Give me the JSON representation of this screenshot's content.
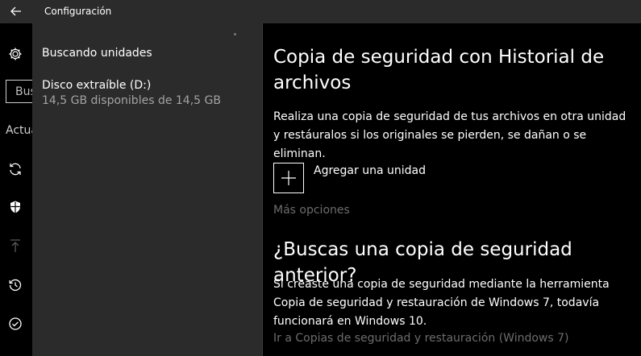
{
  "titlebar": {
    "title": "Configuración",
    "back_icon": "arrow-left-icon"
  },
  "rail": {
    "search_partial": "Bus",
    "section_partial": "Actua",
    "icons": [
      "gear-icon",
      "sync-icon",
      "shield-icon",
      "upload-icon",
      "history-icon",
      "check-circle-icon"
    ]
  },
  "flyout": {
    "searching": "Buscando unidades",
    "drive": {
      "name": "Disco extraíble (D:)",
      "space": "14,5 GB disponibles de 14,5 GB"
    }
  },
  "main": {
    "title": "Copia de seguridad con Historial de archivos",
    "description": "Realiza una copia de seguridad de tus archivos en otra unidad y restáuralos si los originales se pierden, se dañan o se eliminan.",
    "add_drive": "Agregar una unidad",
    "more_options": "Más opciones",
    "older_title": "¿Buscas una copia de seguridad anterior?",
    "older_description": "Si creaste una copia de seguridad mediante la herramienta Copia de seguridad y restauración de Windows 7, todavía funcionará en Windows 10.",
    "older_link": "Ir a Copias de seguridad y restauración (Windows 7)"
  },
  "colors": {
    "titlebar": "#2b2b2b",
    "flyout": "#2b2b2b",
    "muted": "#6d6d6d",
    "subtext": "#a3a3a3"
  }
}
